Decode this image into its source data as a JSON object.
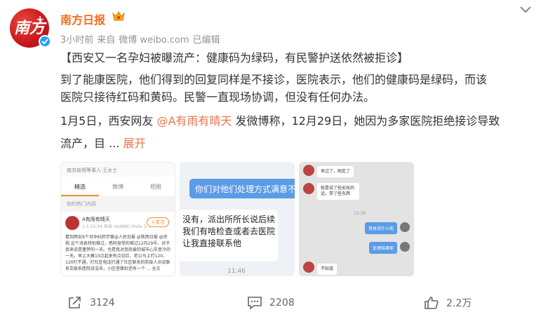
{
  "post": {
    "author": "南方日报",
    "meta": {
      "time": "3小时前",
      "source_prefix": "来自",
      "source": "微博 weibo.com",
      "edited": "已编辑"
    },
    "headline": "【西安又一名孕妇被曝流产：健康码为绿码，有民警护送依然被拒诊】",
    "paragraph1_line1": "到了能康医院，他们得到的回复同样是不接诊，医院表示，他们的健康码是绿码，而该",
    "paragraph1_line2": "医院只接待红码和黄码。民警一直现场协调，但没有任何办法。",
    "paragraph2_before": "1月5日，西安网友 ",
    "mention": "@A有雨有晴天",
    "paragraph2_after": " 发微博称，12月29日，她因为多家医院拒绝接诊导致",
    "paragraph2_line2": "流产，目 ... ",
    "expand_link": "展开"
  },
  "images": {
    "img1": {
      "header": "南京疫情等事人·王女士",
      "tabs": [
        "精选",
        "微博",
        "相册"
      ],
      "section": "你的热门内容",
      "user": "A有雨有晴天",
      "user_sub": "1-5 10:34 来自 HUAWEI Mate 3...",
      "follow": "+关注",
      "body": "看到西安9个月孕妇药学事@人民日报 @陕西日报 @央视 这个消息特别难过，感同身受的难过12月29号，对于我来说是噩梦的一天。也是我对我热爱的城市心灰意冷的一天。早上大概10点起来有点见红，老公马上打120、120打不通，打社区电话打通了社区联系的防疫人员说联系车联系医院说没去，小区里面封还有一个 ... 全文"
    },
    "img2": {
      "bubble1": "你们对他们处理方式满意不",
      "bubble2": "没有，派出所所长说后续我们有啥检查或者去医院让我直接联系他",
      "time": "11:46"
    },
    "img3": {
      "msg1": "来过了，刷走了",
      "msg2": "就是说了些安抚的话，带了些东西",
      "time": "11:30",
      "reply1": "具体说什么啦",
      "reply2": "处理结果呢",
      "msg3": "不知道"
    }
  },
  "actions": {
    "share_count": "3124",
    "comment_count": "2208",
    "like_count": "2.2万"
  },
  "colors": {
    "author": "#f26d1c",
    "link": "#eb7350",
    "verified": "#1fa0ff"
  }
}
